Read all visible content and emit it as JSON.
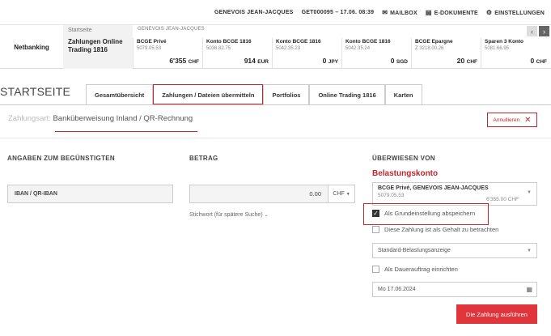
{
  "topbar": {
    "user": "GENEVOIS JEAN-JACQUES",
    "contract": "GET000095",
    "datetime": "– 17.06. 08:39",
    "mailbox": "MAILBOX",
    "edocs": "E-DOKUMENTE",
    "settings": "EINSTELLUNGEN"
  },
  "strip": {
    "netbanking": "Netbanking",
    "start_label": "Startseite",
    "start_title": "Zahlungen Online Trading 1816",
    "holder": "GENEVOIS JEAN-JACQUES",
    "cards": [
      {
        "name": "BCGE Privé",
        "iban": "5079.05.53",
        "amount": "6'355",
        "ccy": "CHF"
      },
      {
        "name": "Konto BCGE 1816",
        "iban": "5036.82.75",
        "amount": "914",
        "ccy": "EUR"
      },
      {
        "name": "Konto BCGE 1816",
        "iban": "5042.35.23",
        "amount": "0",
        "ccy": "JPY"
      },
      {
        "name": "Konto BCGE 1816",
        "iban": "5042.35.24",
        "amount": "0",
        "ccy": "SGD"
      },
      {
        "name": "BCGE Epargne",
        "iban": "Z 3218.00.26",
        "amount": "20",
        "ccy": "CHF"
      },
      {
        "name": "Sparen 3 Konto",
        "iban": "5081.66.95",
        "amount": "0",
        "ccy": "CHF"
      }
    ]
  },
  "page": {
    "title": "STARTSEITE",
    "tabs": [
      "Gesamtübersicht",
      "Zahlungen / Dateien übermitteln",
      "Portfolios",
      "Online Trading 1816",
      "Karten"
    ]
  },
  "form": {
    "ptype_label": "Zahlungsart:",
    "ptype_value": "Banküberweisung Inland / QR-Rechnung",
    "cancel": "Annullieren",
    "h_beneficiary": "ANGABEN ZUM BEGÜNSTIGTEN",
    "h_amount": "BETRAG",
    "h_from": "ÜBERWIESEN VON",
    "debit_account": "Belastungskonto",
    "iban_placeholder": "IBAN / QR-IBAN",
    "amount_value": "0.00",
    "currency": "CHF",
    "keyword": "Stichwort (für spätere Suche)",
    "account_name": "BCGE Privé, GENEVOIS JEAN-JACQUES",
    "account_iban": "5079.05.53",
    "account_balance": "6'355.00 CHF",
    "chk_default": "Als Grundeinstellung abspeichern",
    "chk_salary": "Diese Zahlung ist als Gehalt zu betrachten",
    "debit_display": "Standard-Belastungsanzeige",
    "chk_standing": "Als Dauerauftrag einrichten",
    "date": "Mo 17.06.2024",
    "execute": "Die Zahlung ausführen"
  },
  "colors": {
    "accent": "#c1272d",
    "button": "#e0353b"
  },
  "icons": [
    "mail-icon",
    "document-icon",
    "gear-icon",
    "arrow-left-icon",
    "arrow-right-icon",
    "close-icon",
    "chevron-down-icon",
    "calendar-icon",
    "check-icon"
  ]
}
